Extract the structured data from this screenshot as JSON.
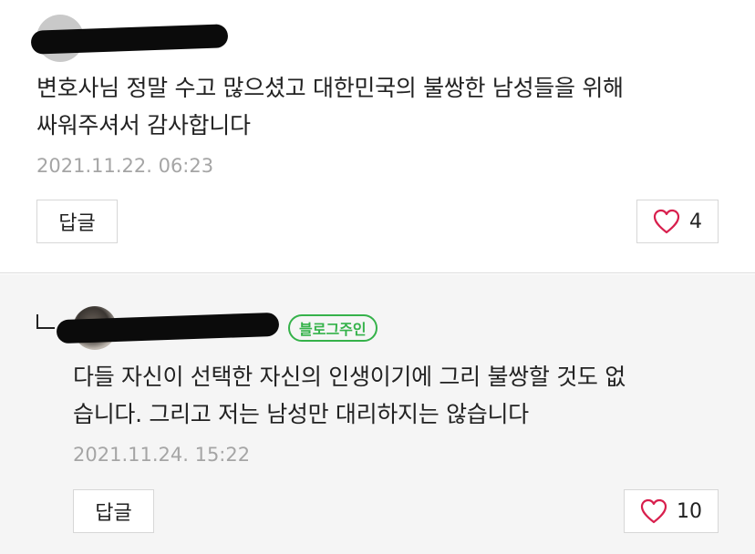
{
  "comments": [
    {
      "text_lines": [
        "변호사님 정말 수고 많으셨고 대한민국의 불쌍한 남성들을 위해",
        "싸워주셔서 감사합니다"
      ],
      "date": "2021.11.22. 06:23",
      "reply_label": "답글",
      "likes": "4"
    },
    {
      "owner_badge": "블로그주인",
      "text_lines": [
        "다들 자신이 선택한 자신의 인생이기에 그리 불쌍할 것도 없",
        "습니다. 그리고 저는 남성만 대리하지는 않습니다"
      ],
      "date": "2021.11.24. 15:22",
      "reply_label": "답글",
      "likes": "10"
    }
  ],
  "colors": {
    "badge": "#35b24a",
    "heart": "#d81f4d",
    "date": "#a5a5a5"
  },
  "icons": {
    "like": "heart-outline-icon",
    "reply_indicator": "reply-arrow-icon"
  }
}
